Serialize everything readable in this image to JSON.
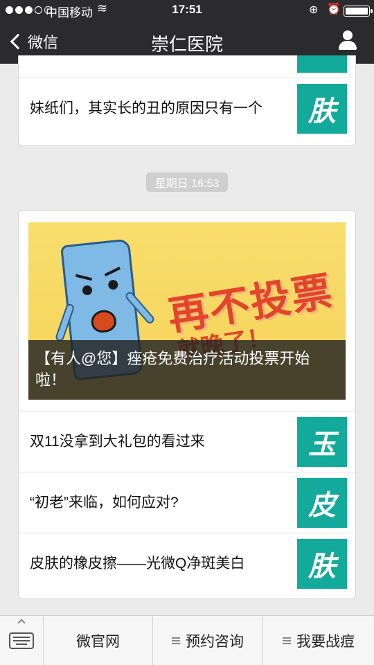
{
  "status_bar": {
    "carrier": "中国移动",
    "time": "17:51"
  },
  "nav": {
    "back_label": "微信",
    "title": "崇仁医院"
  },
  "feed": {
    "card1": {
      "rows": [
        {
          "title": "妹纸们，其实长的丑的原因只有一个",
          "thumb_char": "肤"
        }
      ]
    },
    "timestamp": "星期日 16:53",
    "card2": {
      "hero": {
        "caption": "【有人@您】痤疮免费治疗活动投票开始啦！",
        "image_text": "再不投票",
        "image_text2": "就晚了！"
      },
      "rows": [
        {
          "title": "双11没拿到大礼包的看过来",
          "thumb_char": "玉"
        },
        {
          "title": "“初老”来临，如何应对?",
          "thumb_char": "皮"
        },
        {
          "title": "皮肤的橡皮擦——光微Q净斑美白",
          "thumb_char": "肤"
        }
      ]
    }
  },
  "bottom_menu": {
    "items": [
      {
        "label": "微官网"
      },
      {
        "label": "预约咨询"
      },
      {
        "label": "我要战痘"
      }
    ]
  },
  "colors": {
    "nav_bg": "#2b2b2d",
    "thumb_bg": "#13a99b",
    "hero_bg": "#f7dc6a",
    "slogan": "#e2452a"
  }
}
